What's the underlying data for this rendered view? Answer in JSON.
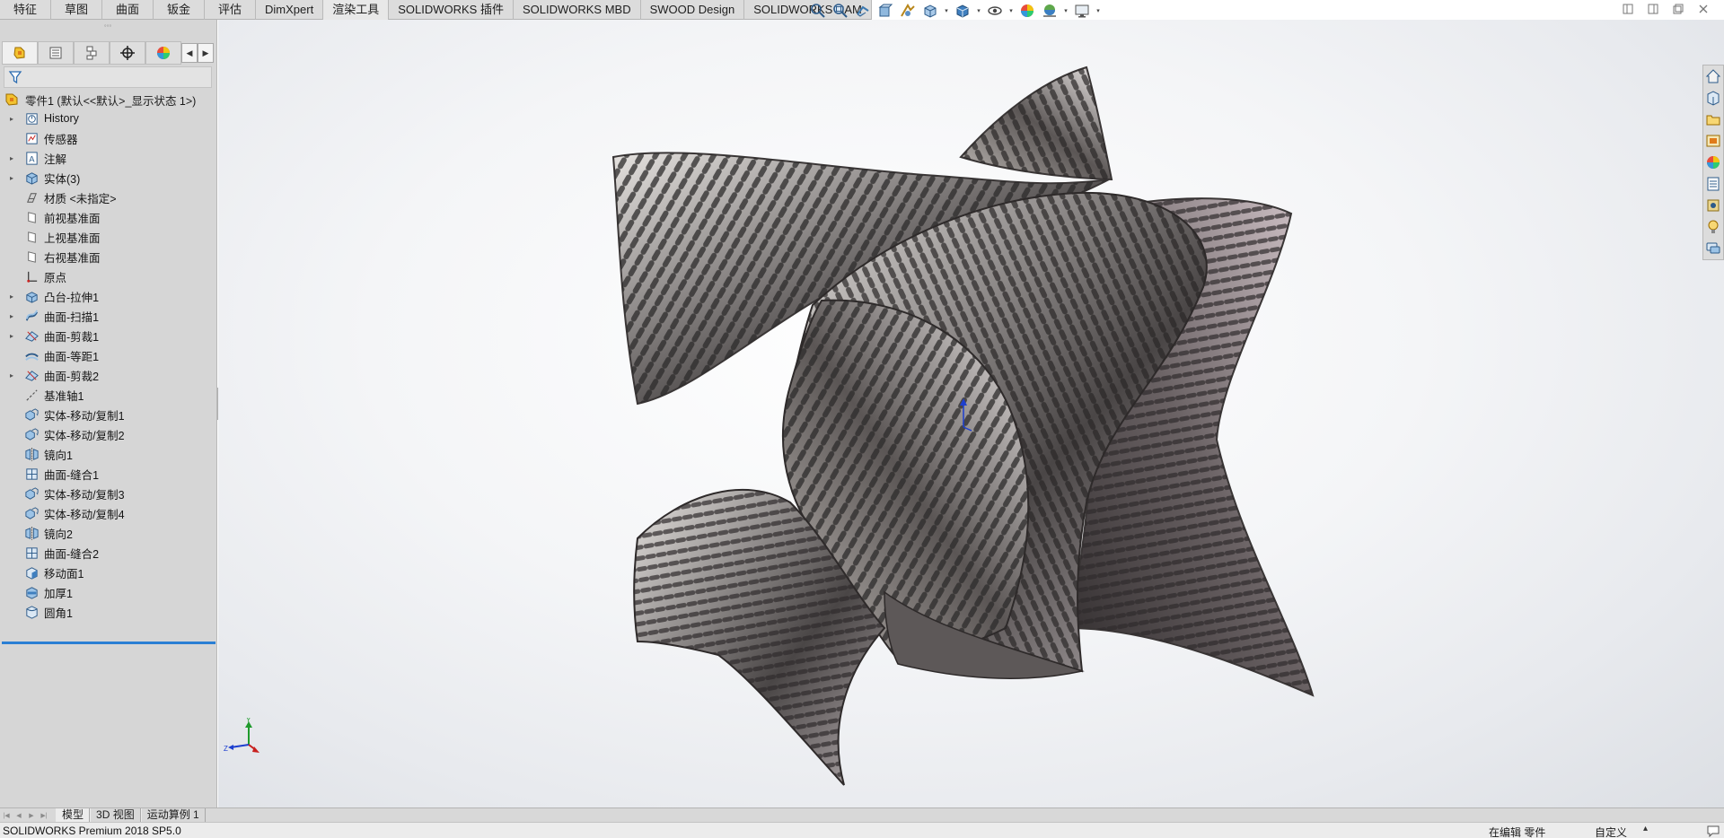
{
  "ribbon": {
    "tabs": [
      "特征",
      "草图",
      "曲面",
      "钣金",
      "评估",
      "DimXpert",
      "渲染工具",
      "SOLIDWORKS 插件",
      "SOLIDWORKS MBD",
      "SWOOD Design",
      "SOLIDWORKS CAM"
    ]
  },
  "heads_up_toolbar": {
    "icons": [
      "zoom-to-fit-icon",
      "zoom-to-area-icon",
      "previous-view-icon",
      "section-view-icon",
      "dynamic-annotation-icon",
      "view-orientation-icon",
      "display-style-icon",
      "hide-show-icon",
      "edit-appearance-icon",
      "apply-scene-icon",
      "view-settings-icon"
    ]
  },
  "feature_tree": {
    "root_label": "零件1  (默认<<默认>_显示状态 1>)",
    "items": [
      {
        "label": "History",
        "icon": "history-icon",
        "expandable": true
      },
      {
        "label": "传感器",
        "icon": "sensor-icon",
        "expandable": false
      },
      {
        "label": "注解",
        "icon": "annotation-icon",
        "expandable": true
      },
      {
        "label": "实体(3)",
        "icon": "solid-bodies-icon",
        "expandable": true
      },
      {
        "label": "材质 <未指定>",
        "icon": "material-icon",
        "expandable": false
      },
      {
        "label": "前视基准面",
        "icon": "plane-icon",
        "expandable": false
      },
      {
        "label": "上视基准面",
        "icon": "plane-icon",
        "expandable": false
      },
      {
        "label": "右视基准面",
        "icon": "plane-icon",
        "expandable": false
      },
      {
        "label": "原点",
        "icon": "origin-icon",
        "expandable": false
      },
      {
        "label": "凸台-拉伸1",
        "icon": "extrude-icon",
        "expandable": true
      },
      {
        "label": "曲面-扫描1",
        "icon": "surface-sweep-icon",
        "expandable": true
      },
      {
        "label": "曲面-剪裁1",
        "icon": "surface-trim-icon",
        "expandable": true
      },
      {
        "label": "曲面-等距1",
        "icon": "surface-offset-icon",
        "expandable": false
      },
      {
        "label": "曲面-剪裁2",
        "icon": "surface-trim-icon",
        "expandable": true
      },
      {
        "label": "基准轴1",
        "icon": "axis-icon",
        "expandable": false
      },
      {
        "label": "实体-移动/复制1",
        "icon": "move-copy-icon",
        "expandable": false
      },
      {
        "label": "实体-移动/复制2",
        "icon": "move-copy-icon",
        "expandable": false
      },
      {
        "label": "镜向1",
        "icon": "mirror-icon",
        "expandable": false
      },
      {
        "label": "曲面-缝合1",
        "icon": "surface-knit-icon",
        "expandable": false
      },
      {
        "label": "实体-移动/复制3",
        "icon": "move-copy-icon",
        "expandable": false
      },
      {
        "label": "实体-移动/复制4",
        "icon": "move-copy-icon",
        "expandable": false
      },
      {
        "label": "镜向2",
        "icon": "mirror-icon",
        "expandable": false
      },
      {
        "label": "曲面-缝合2",
        "icon": "surface-knit-icon",
        "expandable": false
      },
      {
        "label": "移动面1",
        "icon": "move-face-icon",
        "expandable": false
      },
      {
        "label": "加厚1",
        "icon": "thicken-icon",
        "expandable": false
      },
      {
        "label": "圆角1",
        "icon": "fillet-icon",
        "expandable": false
      }
    ]
  },
  "bottom_tabs": [
    "模型",
    "3D 视图",
    "运动算例 1"
  ],
  "status_bar": {
    "product": "SOLIDWORKS Premium 2018 SP5.0",
    "editing": "在编辑 零件",
    "units": "自定义"
  },
  "triad": {
    "x_label": "",
    "y_label": "Y",
    "z_label": "Z"
  },
  "colors": {
    "rollback_bar": "#2a7fd4",
    "x_axis": "#c8201e",
    "y_axis": "#1f9a2c",
    "z_axis": "#1d3fcf"
  }
}
